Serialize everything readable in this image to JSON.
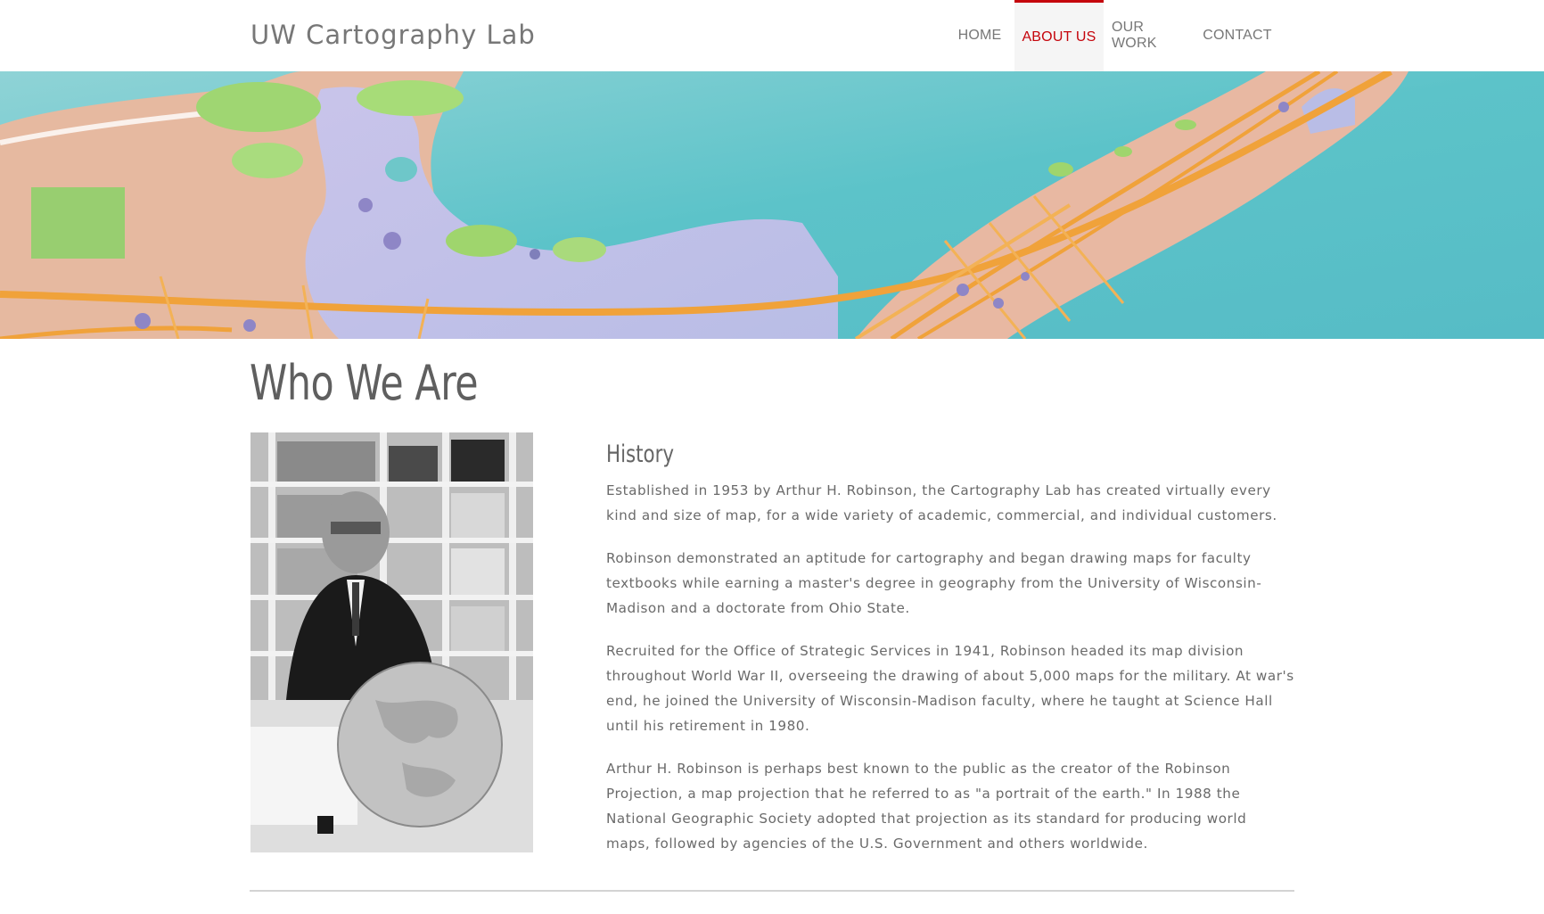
{
  "site": {
    "brand": "UW Cartography Lab"
  },
  "nav": {
    "items": [
      {
        "label": "Home"
      },
      {
        "label": "About Us",
        "active": true
      },
      {
        "label": "Our Work"
      },
      {
        "label": "Contact"
      }
    ]
  },
  "colors": {
    "accent": "#c5050c",
    "text": "#666666",
    "divider": "#d3d3d3"
  },
  "main": {
    "title": "Who We Are",
    "section": {
      "heading": "History",
      "paragraphs": [
        "Established in 1953 by Arthur H. Robinson, the Cartography Lab has created virtually every kind and size of map, for a wide variety of academic, commercial, and individual customers.",
        "Robinson demonstrated an aptitude for cartography and began drawing maps for faculty textbooks while earning a master's degree in geography from the University of Wisconsin-Madison and a doctorate from Ohio State.",
        "Recruited for the Office of Strategic Services in 1941, Robinson headed its map division throughout World War II, overseeing the drawing of about 5,000 maps for the military. At war's end, he joined the University of Wisconsin-Madison faculty, where he taught at Science Hall until his retirement in 1980.",
        "Arthur H. Robinson is perhaps best known to the public as the creator of the Robinson Projection, a map projection that he referred to as \"a portrait of the earth.\" In 1988 the National Geographic Society adopted that projection as its standard for producing world maps, followed by agencies of the U.S. Government and others worldwide."
      ]
    }
  }
}
